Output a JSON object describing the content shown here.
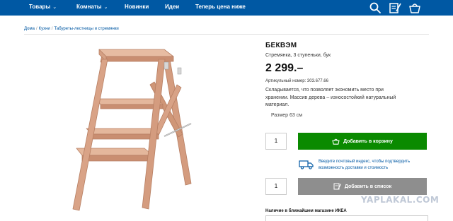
{
  "nav": {
    "items": [
      {
        "label": "Товары",
        "has_dropdown": true
      },
      {
        "label": "Комнаты",
        "has_dropdown": true
      },
      {
        "label": "Новинки",
        "has_dropdown": false
      },
      {
        "label": "Идеи",
        "has_dropdown": false
      },
      {
        "label": "Теперь цена ниже",
        "has_dropdown": false
      }
    ],
    "chevron": "⌄",
    "icons": [
      "search-icon",
      "shopping-list-icon",
      "cart-icon"
    ],
    "color": "#0058a3"
  },
  "breadcrumb": {
    "items": [
      "Дома",
      "Кухни",
      "Табуреты-лестницы и стремянки"
    ],
    "separator": "/"
  },
  "product": {
    "title": "БЕКВЭМ",
    "subtitle": "Стремянка, 3 ступеньки, бук",
    "price": "2 299.–",
    "article": "Артикульный номер: 303.677.66",
    "description": "Складывается, что позволяет экономить место при хранении. Массив дерева – износостойкий натуральный материал.",
    "size": "Размер 63 см",
    "image": "beech-step-stool"
  },
  "purchase": {
    "quantity_cart": "1",
    "add_to_cart_label": "Добавить в корзину",
    "add_to_cart_color": "#0a8a00",
    "delivery_text": "Введите почтовый индекс, чтобы подтвердить возможность доставки и стоимость",
    "quantity_list": "1",
    "add_to_list_label": "Добавить в список",
    "add_to_list_color": "#8e8e8e"
  },
  "store": {
    "title": "Наличие в ближайшем магазине ИКЕА"
  },
  "watermark": "YAPLAKAL.COM"
}
